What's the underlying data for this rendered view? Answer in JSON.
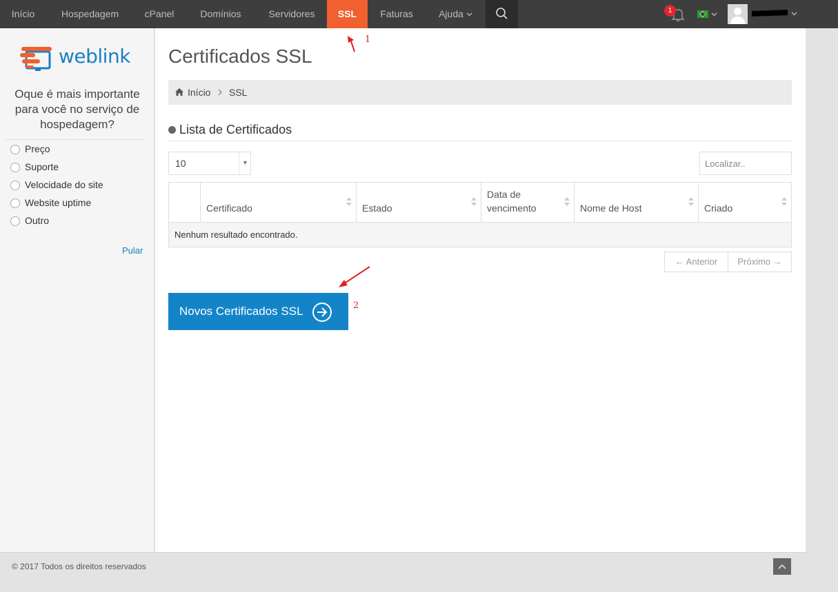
{
  "nav": {
    "items": [
      {
        "label": "Início"
      },
      {
        "label": "Hospedagem"
      },
      {
        "label": "cPanel"
      },
      {
        "label": "Domínios"
      },
      {
        "label": "Servidores"
      },
      {
        "label": "SSL",
        "active": true
      },
      {
        "label": "Faturas"
      },
      {
        "label": "Ajuda",
        "has_dropdown": true
      }
    ],
    "search_icon": "search-icon",
    "notifications_count": "1",
    "language_flag": "brazil-flag",
    "colors": {
      "bar": "#3e3e3e",
      "active": "#f1602e",
      "text": "#bdbdbd"
    }
  },
  "sidebar": {
    "logo_text": "weblink",
    "poll_question": "Oque é mais importante para você no serviço de hospedagem?",
    "options": [
      "Preço",
      "Suporte",
      "Velocidade do site",
      "Website uptime",
      "Outro"
    ],
    "skip_label": "Pular"
  },
  "main": {
    "title": "Certificados SSL",
    "breadcrumb": {
      "home": "Início",
      "current": "SSL"
    },
    "section_title": "Lista de Certificados",
    "page_size": "10",
    "search_placeholder": "Localizar..",
    "columns": [
      "Certificado",
      "Estado",
      "Data de vencimento",
      "Nome de Host",
      "Criado"
    ],
    "empty_message": "Nenhum resultado encontrado.",
    "pager": {
      "prev": "← Anterior",
      "next": "Próximo →"
    },
    "cta_label": "Novos Certificados SSL",
    "cta_color": "#1484c8"
  },
  "annotations": {
    "one": "1",
    "two": "2"
  },
  "footer": {
    "copyright": "© 2017 Todos os direitos reservados"
  }
}
